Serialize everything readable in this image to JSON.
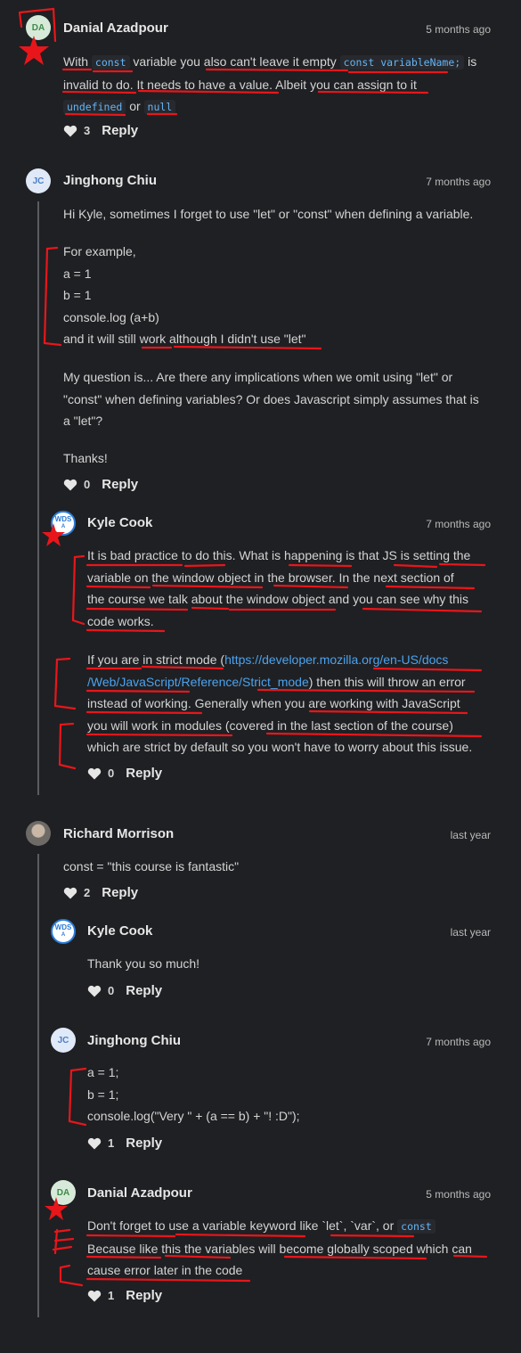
{
  "colors": {
    "background": "#1f2023",
    "text": "#d6d6d6",
    "link": "#4aa3f0",
    "code": "#64b5f6",
    "annotation": "#e8161b"
  },
  "comments": [
    {
      "avatar": "DA",
      "author": "Danial Azadpour",
      "time": "5 months ago",
      "lines": {
        "l1a": "With ",
        "l1code1": "const",
        "l1b": " variable you also can't leave it empty ",
        "l1code2": "const variableName;",
        "l1c": " is",
        "l2": "invalid to do. It needs to have a value. Albeit you can assign to it",
        "l3code1": "undefined",
        "l3a": " or ",
        "l3code2": "null"
      },
      "likes": "3",
      "reply": "Reply"
    },
    {
      "avatar": "JC",
      "author": "Jinghong Chiu",
      "time": "7 months ago",
      "paragraphs": [
        "Hi Kyle, sometimes I forget to use \"let\" or \"const\" when defining a variable.",
        "For example,",
        "a = 1",
        "b = 1",
        "console.log (a+b)",
        "and it will still work although I didn't use \"let\"",
        "My question is... Are there any implications when we omit using \"let\" or",
        "\"const\" when defining variables? Or does Javascript simply assumes that is",
        "a \"let\"?",
        "Thanks!"
      ],
      "likes": "0",
      "reply": "Reply",
      "replies": [
        {
          "avatar": "WDS",
          "author": "Kyle Cook",
          "time": "7 months ago",
          "paragraphs": [
            "It is bad practice to do this. What is happening is that JS is setting the",
            "variable on the window object in the browser. In the next section of",
            "the course we talk about the window object and you can see why this",
            "code works."
          ],
          "p2": {
            "a": "If you are in strict mode (",
            "link1": "https://developer.mozilla.org/en-US/docs",
            "link2": "/Web/JavaScript/Reference/Strict_mode",
            "b": ") then this will throw an error",
            "c": "instead of working. Generally when you are working with JavaScript",
            "d": "you will work in modules (covered in the last section of the course)",
            "e": "which are strict by default so you won't have to worry about this issue."
          },
          "likes": "0",
          "reply": "Reply"
        }
      ]
    },
    {
      "avatar": "",
      "author": "Richard Morrison",
      "time": "last year",
      "text": "const = \"this course is fantastic\"",
      "likes": "2",
      "reply": "Reply",
      "replies": [
        {
          "avatar": "WDS",
          "author": "Kyle Cook",
          "time": "last year",
          "text": "Thank you so much!",
          "likes": "0",
          "reply": "Reply"
        },
        {
          "avatar": "JC",
          "author": "Jinghong Chiu",
          "time": "7 months ago",
          "lines": [
            "a = 1;",
            "b = 1;",
            "console.log(\"Very \" + (a == b) + \"! :D\");"
          ],
          "likes": "1",
          "reply": "Reply"
        },
        {
          "avatar": "DA",
          "author": "Danial Azadpour",
          "time": "5 months ago",
          "l1a": "Don't forget to use a variable keyword like `let`, `var`, or ",
          "l1code": "const",
          "l2": "Because like this the variables will become globally scoped which can",
          "l3": "cause error later in the code",
          "likes": "1",
          "reply": "Reply"
        }
      ]
    }
  ],
  "wds_label": "WDS",
  "wds_sub": "A"
}
